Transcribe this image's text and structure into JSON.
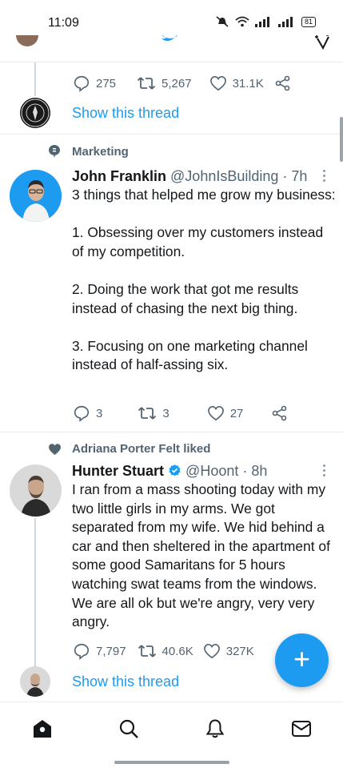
{
  "status_bar": {
    "time": "11:09",
    "battery": "81"
  },
  "previous_tweet": {
    "actions": {
      "replies": "275",
      "retweets": "5,267",
      "likes": "31.1K"
    },
    "show_thread": "Show this thread"
  },
  "tweet1": {
    "context": "Marketing",
    "name": "John Franklin",
    "handle": "@JohnIsBuilding",
    "time": "· 7h",
    "body": "3 things that helped me grow my business:\n\n1. Obsessing over my customers instead of my competition.\n\n2. Doing the work that got me results instead of chasing the next big thing.\n\n3. Focusing on one marketing channel instead of half-assing six.",
    "actions": {
      "replies": "3",
      "retweets": "3",
      "likes": "27"
    }
  },
  "tweet2": {
    "context": "Adriana Porter Felt liked",
    "name": "Hunter Stuart",
    "handle": "@Hoont",
    "time": "· 8h",
    "body": "I ran from a mass shooting today with my two little girls in my arms. We got separated from my wife. We hid behind a car and then sheltered in the apartment of some good Samaritans for 5 hours watching swat teams from the windows. We are all ok but we're angry, very very angry.",
    "actions": {
      "replies": "7,797",
      "retweets": "40.6K",
      "likes": "327K"
    },
    "show_thread": "Show this thread"
  },
  "fab": {
    "label": "+"
  },
  "colors": {
    "accent": "#1d9bf0",
    "text": "#14171a",
    "muted": "#536471",
    "divider": "#e6ecf0"
  },
  "icons": [
    "reply-icon",
    "retweet-icon",
    "like-icon",
    "share-icon",
    "topic-icon",
    "heart-icon",
    "verified-icon",
    "home-icon",
    "search-icon",
    "notifications-icon",
    "messages-icon",
    "twitter-bird-icon",
    "sparkle-icon"
  ]
}
